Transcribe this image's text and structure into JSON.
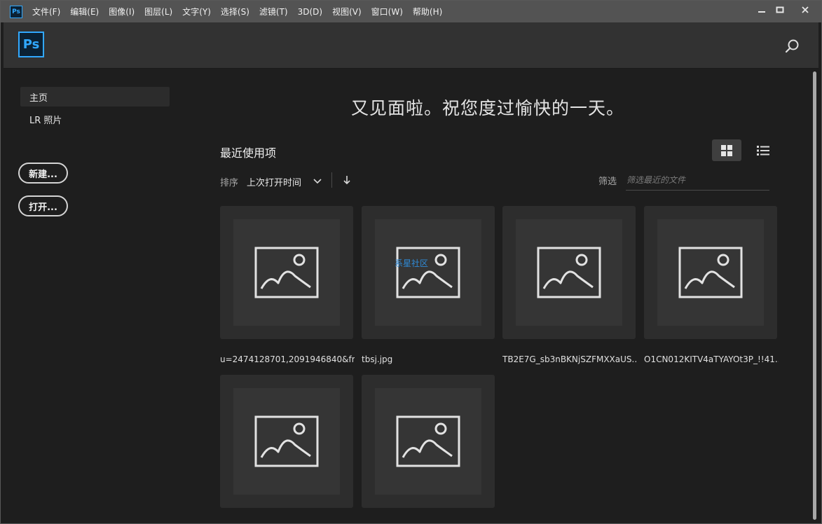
{
  "menubar": {
    "app_icon_text": "Ps",
    "items": [
      "文件(F)",
      "编辑(E)",
      "图像(I)",
      "图层(L)",
      "文字(Y)",
      "选择(S)",
      "滤镜(T)",
      "3D(D)",
      "视图(V)",
      "窗口(W)",
      "帮助(H)"
    ],
    "window_controls": [
      "—",
      "☐",
      "✕"
    ]
  },
  "header": {
    "logo_text": "Ps"
  },
  "sidebar": {
    "nav_items": [
      "主页",
      "LR 照片"
    ],
    "new_button": "新建...",
    "open_button": "打开..."
  },
  "main": {
    "greeting": "又见面啦。祝您度过愉快的一天。",
    "section_title": "最近使用项",
    "sort_label": "排序",
    "sort_value": "上次打开时间",
    "filter_label": "筛选",
    "filter_placeholder": "筛选最近的文件",
    "files": [
      "u=2474128701,2091946840&fm...",
      "tbsj.jpg",
      "TB2E7G_sb3nBKNjSZFMXXaUS...",
      "O1CN012KITV4aTYAYOt3P_!!41...",
      "",
      ""
    ],
    "watermark": "系星社区"
  },
  "colors": {
    "ps_blue": "#31a8ff",
    "ps_dark": "#0b2134",
    "background": "#1e1e1e",
    "menubar": "#535353"
  }
}
